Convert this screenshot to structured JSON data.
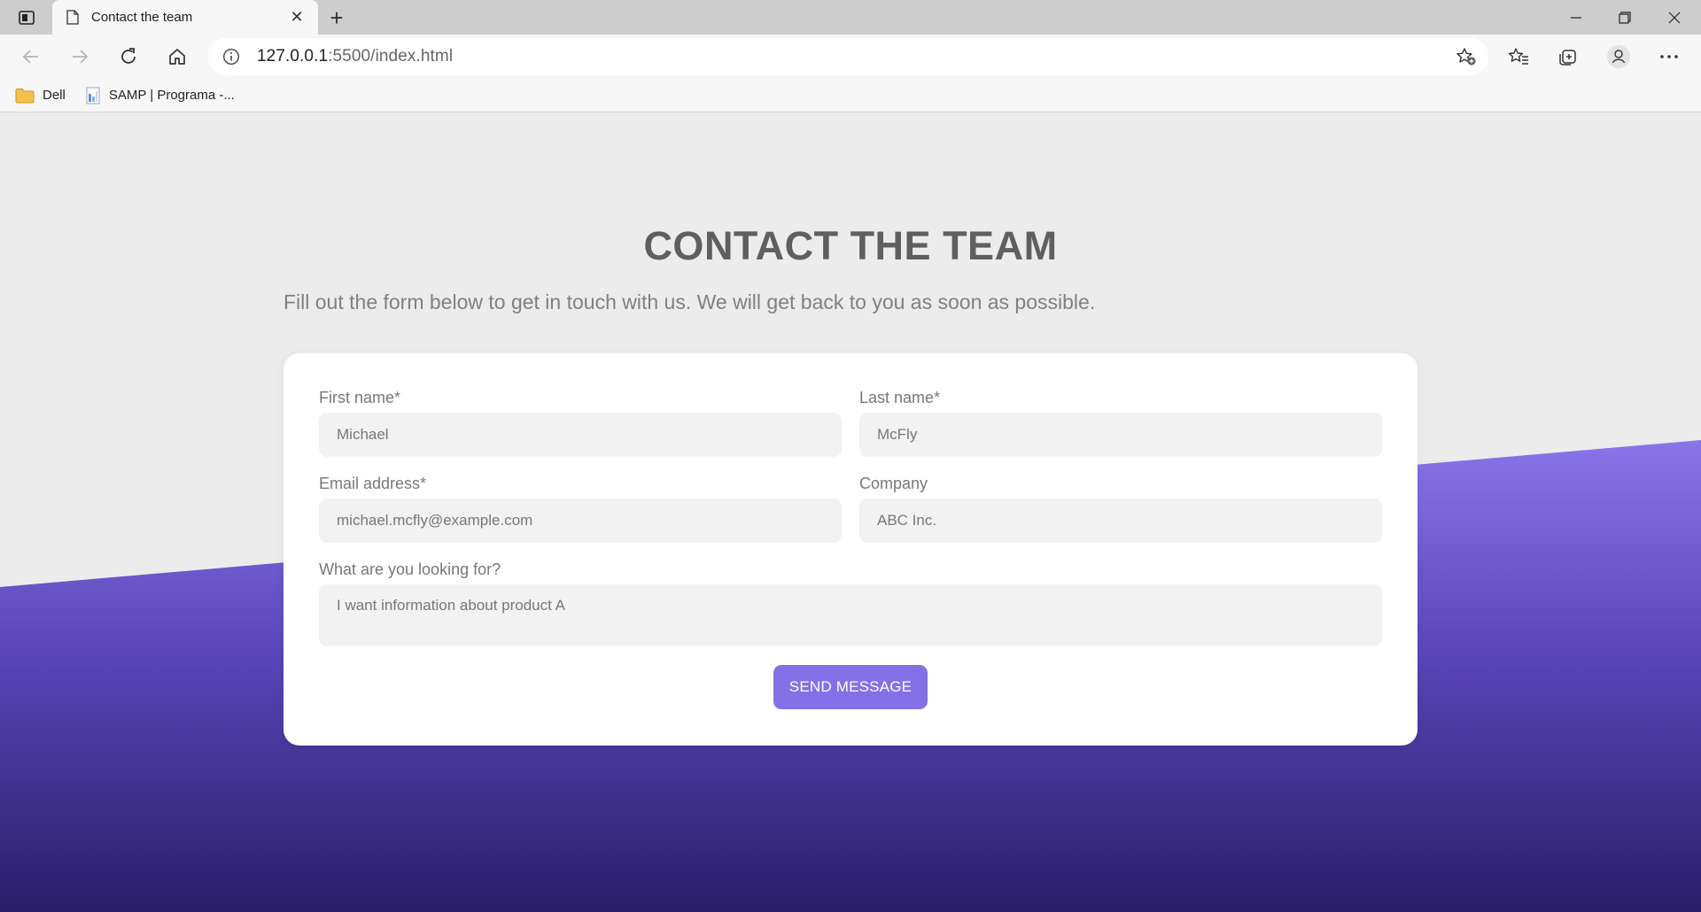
{
  "browser": {
    "tab": {
      "title": "Contact the team",
      "close_glyph": "✕"
    },
    "new_tab_glyph": "+",
    "address": {
      "host": "127.0.0.1",
      "rest": ":5500/index.html"
    },
    "bookmarks": [
      {
        "label": "Dell",
        "icon": "folder-icon"
      },
      {
        "label": "SAMP | Programa -...",
        "icon": "page-icon"
      }
    ]
  },
  "page": {
    "title": "CONTACT THE TEAM",
    "subtitle": "Fill out the form below to get in touch with us. We will get back to you as soon as possible.",
    "form": {
      "first_name": {
        "label": "First name*",
        "placeholder": "Michael"
      },
      "last_name": {
        "label": "Last name*",
        "placeholder": "McFly"
      },
      "email": {
        "label": "Email address*",
        "placeholder": "michael.mcfly@example.com"
      },
      "company": {
        "label": "Company",
        "placeholder": "ABC Inc."
      },
      "message": {
        "label": "What are you looking for?",
        "placeholder": "I want information about product A"
      },
      "submit_label": "SEND MESSAGE"
    }
  },
  "colors": {
    "accent": "#8470e6",
    "gradient_top": "#8a74ea",
    "gradient_bottom": "#2a1e68",
    "page_bg": "#ececec"
  }
}
